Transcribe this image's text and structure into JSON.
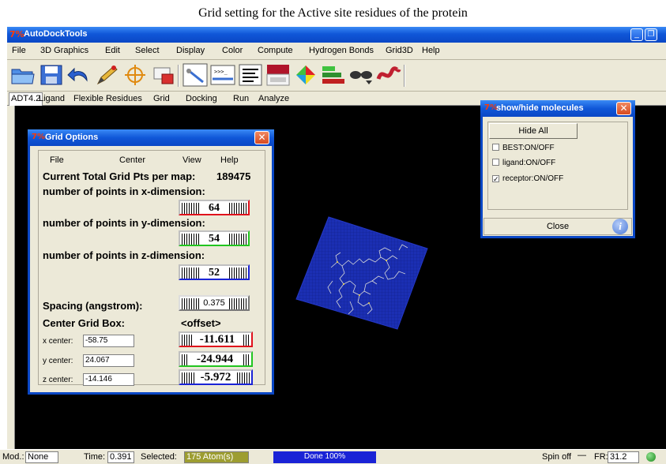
{
  "caption": "Grid setting for the Active site residues of the protein",
  "window": {
    "title": "AutoDockTools",
    "icon": "Tk-feather-icon",
    "buttons": [
      "minimize",
      "restore"
    ]
  },
  "menubar": [
    "File",
    "3D Graphics",
    "Edit",
    "Select",
    "Display",
    "Color",
    "Compute",
    "Hydrogen Bonds",
    "Grid3D",
    "Help"
  ],
  "toolbar_icons": [
    "open-folder-icon",
    "save-icon",
    "undo-arrow-icon",
    "pick-pencil-icon",
    "center-target-icon",
    "selection-icon",
    "measure-icon",
    "python-shell-icon",
    "lines-icon",
    "color-palette-icon",
    "cpk-sphere-icon",
    "msms-surface-icon",
    "stereo-glasses-icon",
    "ribbon-icon"
  ],
  "tabs": [
    "ADT4.2",
    "Ligand",
    "Flexible Residues",
    "Grid",
    "Docking",
    "Run",
    "Analyze"
  ],
  "grid_options": {
    "title": "Grid Options",
    "menu": [
      "File",
      "Center",
      "View",
      "Help"
    ],
    "total_label": "Current Total Grid Pts per map:",
    "total_value": "189475",
    "x_label": "number of points in x-dimension:",
    "x_value": "64",
    "y_label": "number of points in y-dimension:",
    "y_value": "54",
    "z_label": "number of points in z-dimension:",
    "z_value": "52",
    "spacing_label": "Spacing (angstrom):",
    "spacing_value": "0.375",
    "center_label": "Center Grid Box:",
    "offset_label": "<offset>",
    "x_center_label": "x center:",
    "x_center_value": "-58.75",
    "x_offset": "-11.611",
    "y_center_label": "y center:",
    "y_center_value": "24.067",
    "y_offset": "-24.944",
    "z_center_label": "z center:",
    "z_center_value": "-14.146",
    "z_offset": "-5.972"
  },
  "show_hide": {
    "title": "show/hide molecules",
    "hide_all_label": "Hide All",
    "items": [
      {
        "label": "BEST:ON/OFF",
        "checked": false
      },
      {
        "label": "ligand:ON/OFF",
        "checked": false
      },
      {
        "label": "receptor:ON/OFF",
        "checked": true
      }
    ],
    "close_label": "Close"
  },
  "status": {
    "mod_label": "Mod.:",
    "mod_value": "None",
    "time_label": "Time:",
    "time_value": "0.391",
    "selected_label": "Selected:",
    "selected_value": "175 Atom(s)",
    "progress_text": "Done 100%",
    "progress_fraction": 1.0,
    "spin_label": "Spin off",
    "fr_label": "FR:",
    "fr_value": "31.2"
  },
  "colors": {
    "title_blue": "#0a47c5",
    "viewer_bg": "#000000",
    "grid_box": "#1b2fb3",
    "red_thumb": "#e0101c",
    "green_thumb": "#22c520",
    "blue_thumb": "#1a23d6"
  }
}
